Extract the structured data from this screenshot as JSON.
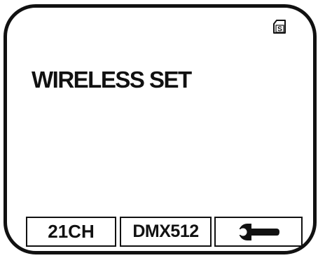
{
  "status": {
    "icon": "s-card-icon",
    "icon_letter": "S"
  },
  "screen": {
    "title": "WIRELESS SET"
  },
  "softkeys": [
    {
      "label": "21CH"
    },
    {
      "label": "DMX512"
    },
    {
      "icon": "wrench-icon"
    }
  ]
}
